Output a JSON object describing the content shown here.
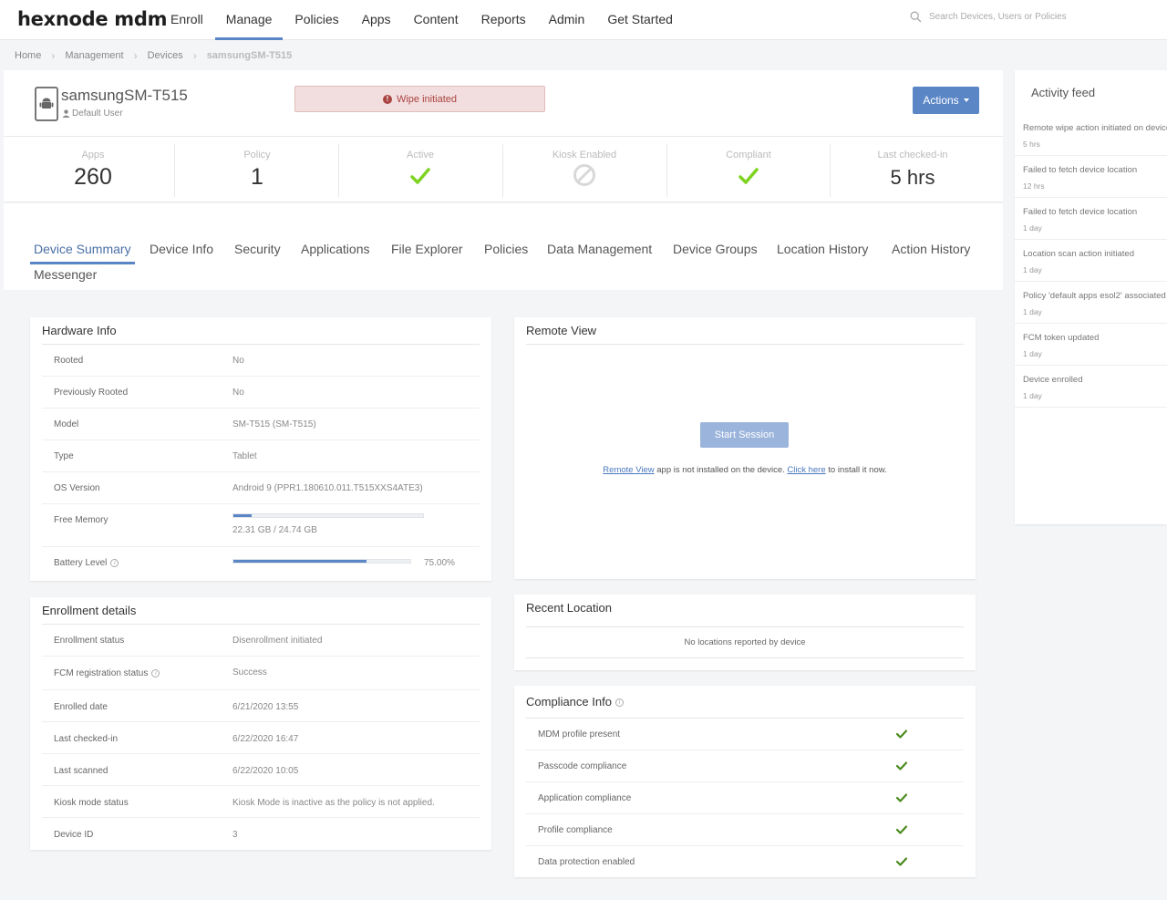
{
  "nav": {
    "logo": "hexnode mdm",
    "items": [
      "Enroll",
      "Manage",
      "Policies",
      "Apps",
      "Content",
      "Reports",
      "Admin",
      "Get Started"
    ],
    "active": "Manage",
    "search_placeholder": "Search Devices, Users or Policies"
  },
  "breadcrumb": {
    "items": [
      "Home",
      "Management",
      "Devices"
    ],
    "current": "samsungSM-T515"
  },
  "device": {
    "name": "samsungSM-T515",
    "user": "Default User",
    "alert": "Wipe initiated",
    "actions_label": "Actions"
  },
  "stats": [
    {
      "label": "Apps",
      "value": "260"
    },
    {
      "label": "Policy",
      "value": "1"
    },
    {
      "label": "Active",
      "value": "",
      "icon": "check-icon"
    },
    {
      "label": "Kiosk Enabled",
      "value": "",
      "icon": "disabled-icon"
    },
    {
      "label": "Compliant",
      "value": "",
      "icon": "check-icon"
    },
    {
      "label": "Last checked-in",
      "value": "5 hrs"
    }
  ],
  "tabs": [
    "Device Summary",
    "Device Info",
    "Security",
    "Applications",
    "File Explorer",
    "Policies",
    "Data Management",
    "Device Groups",
    "Location History",
    "Action History",
    "Messenger"
  ],
  "active_tab": "Device Summary",
  "hardware": {
    "title": "Hardware Info",
    "rows": [
      {
        "key": "Rooted",
        "value": "No"
      },
      {
        "key": "Previously Rooted",
        "value": "No"
      },
      {
        "key": "Model",
        "value": "SM-T515 (SM-T515)"
      },
      {
        "key": "Type",
        "value": "Tablet"
      },
      {
        "key": "OS Version",
        "value": "Android 9 (PPR1.180610.011.T515XXS4ATE3)"
      },
      {
        "key": "Free Memory",
        "value": "22.31 GB / 24.74 GB",
        "fraction": 0.098
      },
      {
        "key": "Battery Level",
        "value": "75.00%",
        "fraction": 0.75
      }
    ]
  },
  "enrollment": {
    "title": "Enrollment details",
    "rows": [
      {
        "key": "Enrollment status",
        "value": "Disenrollment initiated"
      },
      {
        "key": "FCM registration status",
        "value": "Success"
      },
      {
        "key": "Enrolled date",
        "value": "6/21/2020 13:55"
      },
      {
        "key": "Last checked-in",
        "value": "6/22/2020 16:47"
      },
      {
        "key": "Last scanned",
        "value": "6/22/2020 10:05"
      },
      {
        "key": "Kiosk mode status",
        "value": "Kiosk Mode is inactive as the policy is not applied."
      },
      {
        "key": "Device ID",
        "value": "3"
      }
    ]
  },
  "remote_view": {
    "title": "Remote View",
    "button": "Start Session",
    "note_link1": "Remote View",
    "note_mid": " app is not installed on the device. ",
    "note_link2": "Click here",
    "note_end": " to install it now."
  },
  "recent_location": {
    "title": "Recent Location",
    "message": "No locations reported by device"
  },
  "compliance": {
    "title": "Compliance Info",
    "rows": [
      "MDM profile present",
      "Passcode compliance",
      "Application compliance",
      "Profile compliance",
      "Data protection enabled"
    ]
  },
  "feed": {
    "title": "Activity feed",
    "items": [
      {
        "text": "Remote wipe action initiated on device",
        "time": "5 hrs"
      },
      {
        "text": "Failed to fetch device location",
        "time": "12 hrs"
      },
      {
        "text": "Failed to fetch device location",
        "time": "1 day"
      },
      {
        "text": "Location scan action initiated",
        "time": "1 day"
      },
      {
        "text": "Policy 'default apps esol2' associated",
        "time": "1 day"
      },
      {
        "text": "FCM token updated",
        "time": "1 day"
      },
      {
        "text": "Device enrolled",
        "time": "1 day"
      }
    ]
  },
  "colors": {
    "accent": "#5a86c6",
    "check": "#7ed321",
    "alert_bg": "#f2dede",
    "alert_text": "#a94442"
  }
}
